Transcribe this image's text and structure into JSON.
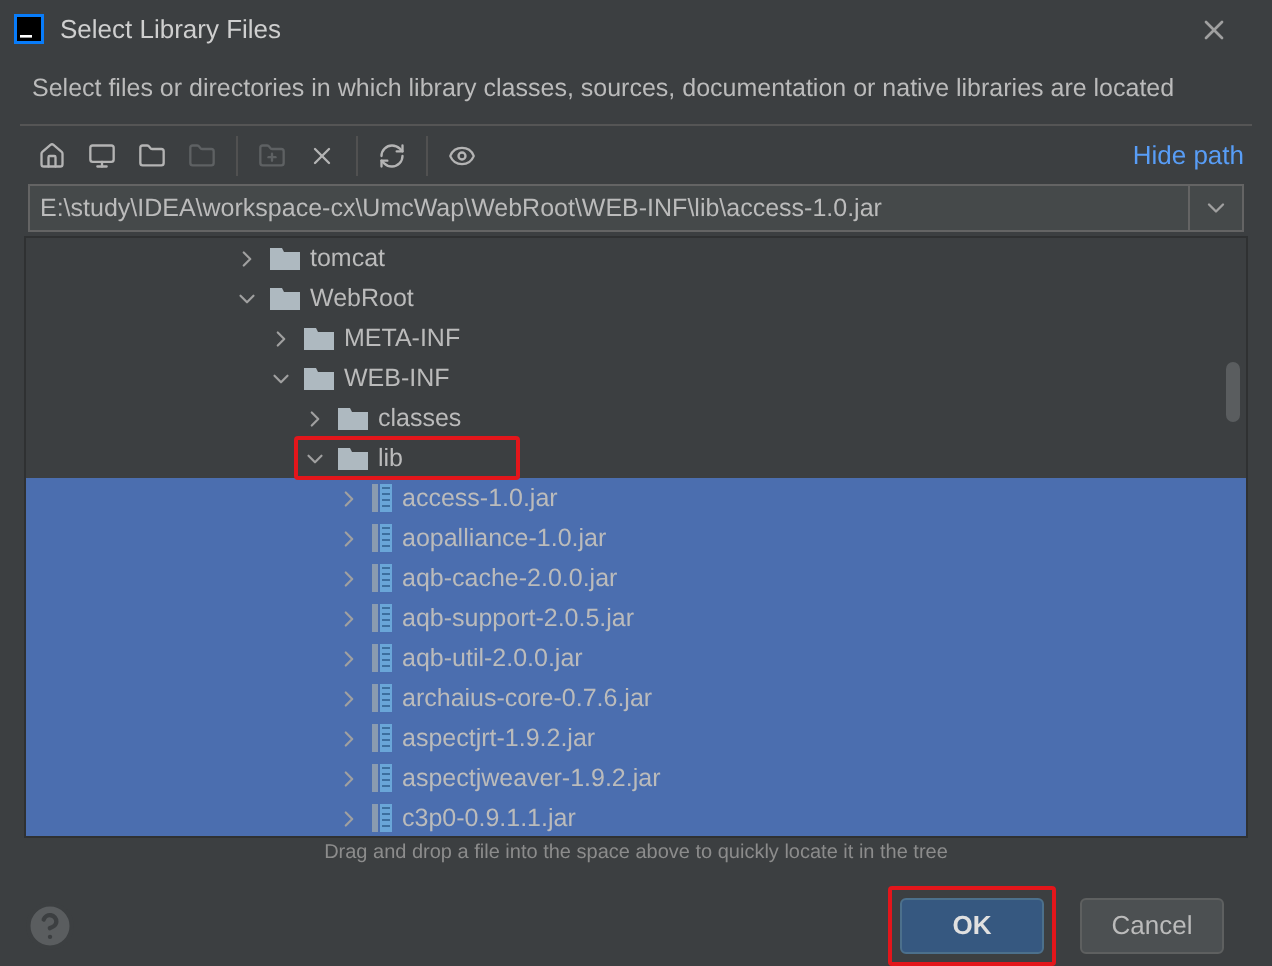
{
  "window": {
    "title": "Select Library Files"
  },
  "description": "Select files or directories in which library classes, sources, documentation or native libraries are located",
  "toolbar": [
    {
      "disabled": false
    },
    {
      "disabled": false
    },
    {
      "disabled": false
    },
    {
      "disabled": true
    },
    {
      "disabled": true
    },
    {
      "disabled": false
    },
    {
      "disabled": false
    },
    {
      "disabled": false
    }
  ],
  "hide_path_link": "Hide path",
  "path_field": {
    "value": "E:\\study\\IDEA\\workspace-cx\\UmcWap\\WebRoot\\WEB-INF\\lib\\access-1.0.jar"
  },
  "tree": [
    {
      "name": "tomcat",
      "kind": "folder",
      "expanded": false,
      "selected": false,
      "annotated": false
    },
    {
      "name": "WebRoot",
      "kind": "folder",
      "expanded": true,
      "selected": false,
      "annotated": false,
      "children": [
        {
          "name": "META-INF",
          "kind": "folder",
          "expanded": false,
          "selected": false,
          "annotated": false
        },
        {
          "name": "WEB-INF",
          "kind": "folder",
          "expanded": true,
          "selected": false,
          "annotated": false,
          "children": [
            {
              "name": "classes",
              "kind": "folder",
              "expanded": false,
              "selected": false,
              "annotated": false
            },
            {
              "name": "lib",
              "kind": "folder",
              "expanded": true,
              "selected": false,
              "annotated": true,
              "children": [
                {
                  "name": "access-1.0.jar",
                  "kind": "jar",
                  "expanded": false,
                  "selected": true,
                  "annotated": false
                },
                {
                  "name": "aopalliance-1.0.jar",
                  "kind": "jar",
                  "expanded": false,
                  "selected": true,
                  "annotated": false
                },
                {
                  "name": "aqb-cache-2.0.0.jar",
                  "kind": "jar",
                  "expanded": false,
                  "selected": true,
                  "annotated": false
                },
                {
                  "name": "aqb-support-2.0.5.jar",
                  "kind": "jar",
                  "expanded": false,
                  "selected": true,
                  "annotated": false
                },
                {
                  "name": "aqb-util-2.0.0.jar",
                  "kind": "jar",
                  "expanded": false,
                  "selected": true,
                  "annotated": false
                },
                {
                  "name": "archaius-core-0.7.6.jar",
                  "kind": "jar",
                  "expanded": false,
                  "selected": true,
                  "annotated": false
                },
                {
                  "name": "aspectjrt-1.9.2.jar",
                  "kind": "jar",
                  "expanded": false,
                  "selected": true,
                  "annotated": false
                },
                {
                  "name": "aspectjweaver-1.9.2.jar",
                  "kind": "jar",
                  "expanded": false,
                  "selected": true,
                  "annotated": false
                },
                {
                  "name": "c3p0-0.9.1.1.jar",
                  "kind": "jar",
                  "expanded": false,
                  "selected": true,
                  "annotated": false
                }
              ]
            }
          ]
        }
      ]
    }
  ],
  "hint": "Drag and drop a file into the space above to quickly locate it in the tree",
  "buttons": [
    {
      "label": "OK",
      "kind": "primary",
      "annotated": true
    },
    {
      "label": "Cancel",
      "kind": "secondary",
      "annotated": false
    }
  ]
}
